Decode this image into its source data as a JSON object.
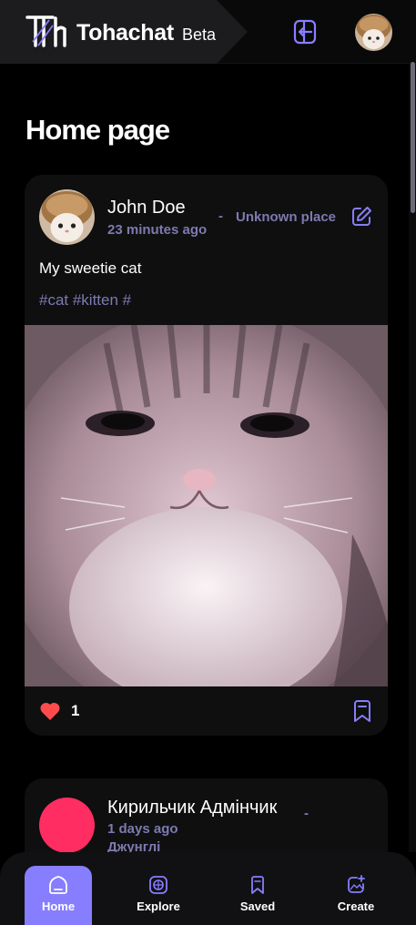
{
  "header": {
    "brand_name": "Tohachat",
    "brand_tag": "Beta",
    "logout_icon": "logout-icon",
    "avatar_icon": "profile-avatar"
  },
  "main": {
    "page_title": "Home page",
    "posts": [
      {
        "author": "John Doe",
        "time": "23 minutes ago",
        "separator": "-",
        "location": "Unknown place",
        "caption": "My sweetie cat",
        "tags": "#cat #kitten #",
        "likes": "1",
        "image": "kitten-photo"
      },
      {
        "author": "Кирильчик Адмінчик",
        "separator": "-",
        "time": "1 days ago",
        "location": "Джунглі"
      }
    ]
  },
  "nav": {
    "items": [
      {
        "label": "Home",
        "icon": "home-icon"
      },
      {
        "label": "Explore",
        "icon": "explore-icon"
      },
      {
        "label": "Saved",
        "icon": "bookmark-icon"
      },
      {
        "label": "Create",
        "icon": "create-post-icon"
      }
    ]
  },
  "colors": {
    "accent": "#877eff",
    "muted": "#7d7ab0",
    "like": "#ff4b4b",
    "avatar_placeholder": "#ff2d62",
    "card": "#0f0f10"
  }
}
